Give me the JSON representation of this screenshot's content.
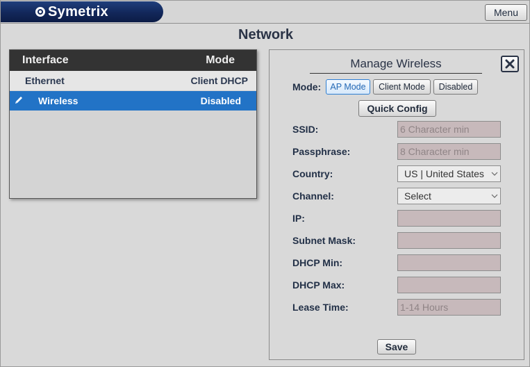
{
  "app": {
    "brand": "Symetrix",
    "menu_label": "Menu"
  },
  "page": {
    "title": "Network"
  },
  "interfaces": {
    "headers": {
      "interface": "Interface",
      "mode": "Mode"
    },
    "rows": [
      {
        "name": "Ethernet",
        "mode": "Client DHCP",
        "selected": false
      },
      {
        "name": "Wireless",
        "mode": "Disabled",
        "selected": true,
        "icon": "pencil-icon"
      }
    ]
  },
  "wireless": {
    "title": "Manage Wireless",
    "close_icon": "close-icon",
    "mode_label": "Mode:",
    "modes": [
      "AP Mode",
      "Client Mode",
      "Disabled"
    ],
    "active_mode": "AP Mode",
    "quick_config_label": "Quick Config",
    "fields": {
      "ssid": {
        "label": "SSID:",
        "placeholder": "6 Character min"
      },
      "passphrase": {
        "label": "Passphrase:",
        "placeholder": "8 Character min"
      },
      "country": {
        "label": "Country:",
        "value": "US | United States"
      },
      "channel": {
        "label": "Channel:",
        "value": "Select"
      },
      "ip": {
        "label": "IP:",
        "value": ""
      },
      "subnet_mask": {
        "label": "Subnet Mask:",
        "value": ""
      },
      "dhcp_min": {
        "label": "DHCP Min:",
        "value": ""
      },
      "dhcp_max": {
        "label": "DHCP Max:",
        "value": ""
      },
      "lease_time": {
        "label": "Lease Time:",
        "placeholder": "1-14 Hours"
      }
    },
    "save_label": "Save"
  },
  "colors": {
    "brand_navy": "#12275a",
    "selection_blue": "#2273c6",
    "disabled_field": "#c7b9bb"
  }
}
